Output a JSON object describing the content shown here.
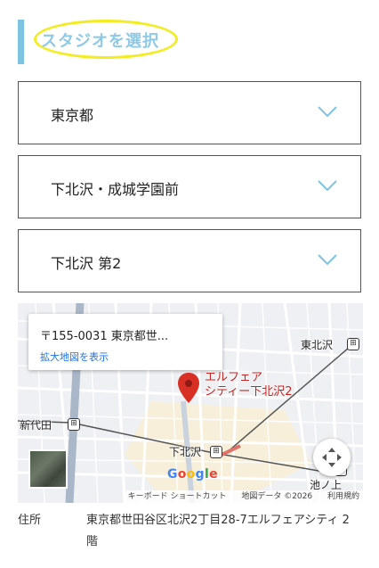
{
  "header": {
    "title": "スタジオを選択"
  },
  "selects": [
    {
      "value": "東京都"
    },
    {
      "value": "下北沢・成城学園前"
    },
    {
      "value": "下北沢 第2"
    }
  ],
  "map": {
    "info_address": "〒155-0031 東京都世...",
    "info_link": "拡大地図を表示",
    "place_name_line1": "エルフェア",
    "place_name_line2": "シティー下北沢2",
    "stations": {
      "higashi_kitazawa": "東北沢",
      "shin_daita": "新代田",
      "shimokitazawa": "下北沢",
      "ikenoue": "池ノ上"
    },
    "google_logo": "Google",
    "attribution": {
      "keyboard": "キーボード ショートカット",
      "map_data": "地図データ ©2026",
      "terms": "利用規約"
    }
  },
  "address": {
    "label": "住所",
    "value": "東京都世田谷区北沢2丁目28-7エルフェアシティ 2階"
  },
  "colors": {
    "accent": "#7fc3e3",
    "highlight": "#f2ec21",
    "link": "#1a73e8",
    "pin": "#d93025"
  }
}
